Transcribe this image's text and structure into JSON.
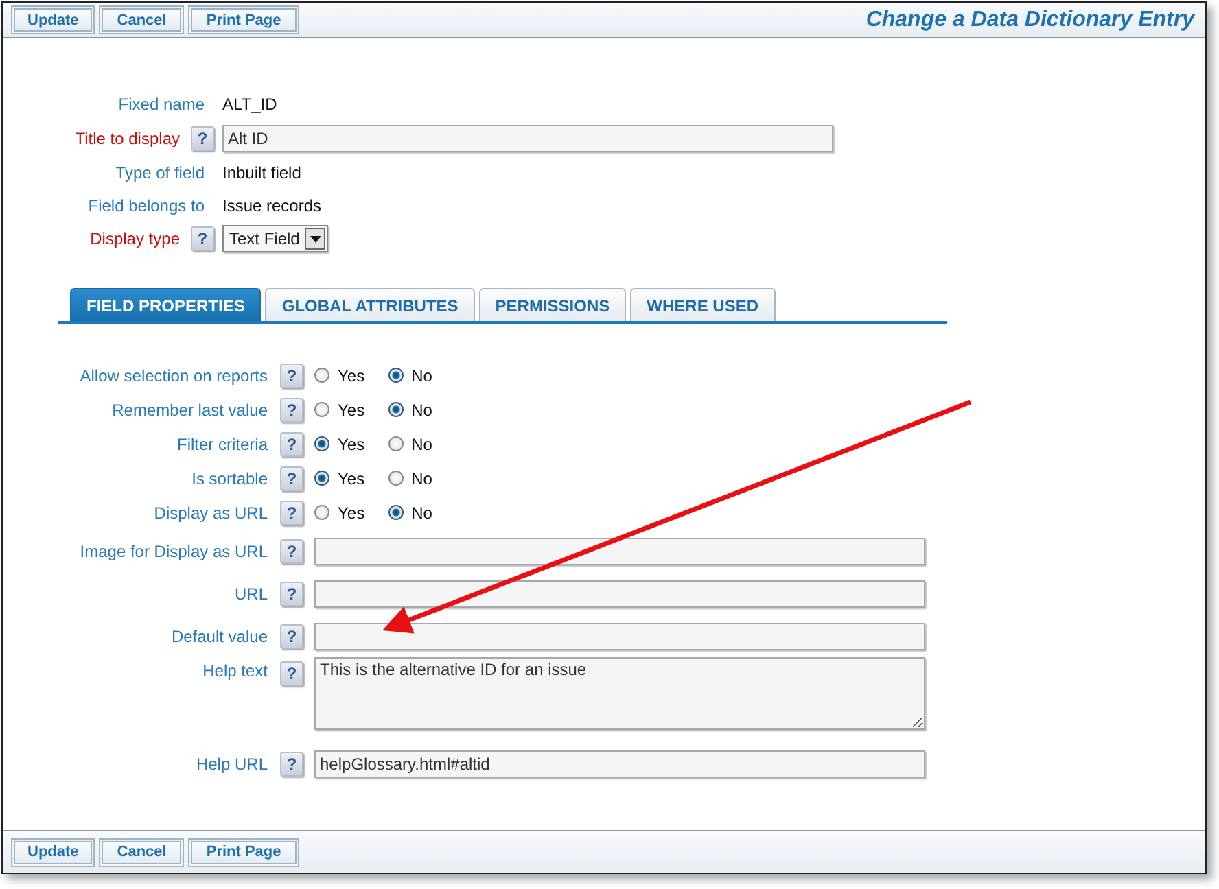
{
  "top_toolbar": {
    "buttons": [
      "Update",
      "Cancel",
      "Print Page"
    ]
  },
  "page_title": "Change a Data Dictionary Entry",
  "header_fields": [
    {
      "label": "Fixed name",
      "required": false,
      "kind": "text",
      "value": "ALT_ID"
    },
    {
      "label": "Title to display",
      "required": true,
      "help": "?",
      "kind": "input",
      "value": "Alt ID"
    },
    {
      "label": "Type of field",
      "required": false,
      "kind": "text",
      "value": "Inbuilt field"
    },
    {
      "label": "Field belongs to",
      "required": false,
      "kind": "text",
      "value": "Issue records"
    },
    {
      "label": "Display type",
      "required": true,
      "help": "?",
      "kind": "select",
      "value": "Text Field"
    }
  ],
  "tabs": [
    {
      "label": "FIELD PROPERTIES",
      "selected": true
    },
    {
      "label": "GLOBAL ATTRIBUTES",
      "selected": false
    },
    {
      "label": "PERMISSIONS",
      "selected": false
    },
    {
      "label": "WHERE USED",
      "selected": false
    }
  ],
  "properties": [
    {
      "label": "Allow selection on reports",
      "help": "?",
      "kind": "radio",
      "options": [
        {
          "label": "Yes",
          "selected": false
        },
        {
          "label": "No",
          "selected": true
        }
      ]
    },
    {
      "label": "Remember last value",
      "help": "?",
      "kind": "radio",
      "options": [
        {
          "label": "Yes",
          "selected": false
        },
        {
          "label": "No",
          "selected": true
        }
      ]
    },
    {
      "label": "Filter criteria",
      "help": "?",
      "kind": "radio",
      "options": [
        {
          "label": "Yes",
          "selected": true
        },
        {
          "label": "No",
          "selected": false
        }
      ]
    },
    {
      "label": "Is sortable",
      "help": "?",
      "kind": "radio",
      "options": [
        {
          "label": "Yes",
          "selected": true
        },
        {
          "label": "No",
          "selected": false
        }
      ]
    },
    {
      "label": "Display as URL",
      "help": "?",
      "kind": "radio",
      "options": [
        {
          "label": "Yes",
          "selected": false
        },
        {
          "label": "No",
          "selected": true
        }
      ]
    },
    {
      "label": "Image for Display as URL",
      "help": "?",
      "kind": "input"
    },
    {
      "label": "URL",
      "help": "?",
      "kind": "input"
    },
    {
      "label": "Default value",
      "help": "?",
      "kind": "input"
    },
    {
      "label": "Help text",
      "help": "?",
      "kind": "textarea",
      "value": "This is the alternative ID for an issue"
    },
    {
      "label": "Help URL",
      "help": "?",
      "kind": "input",
      "value": "helpGlossary.html#altid"
    }
  ],
  "bottom_toolbar": {
    "buttons": [
      "Update",
      "Cancel",
      "Print Page"
    ]
  }
}
